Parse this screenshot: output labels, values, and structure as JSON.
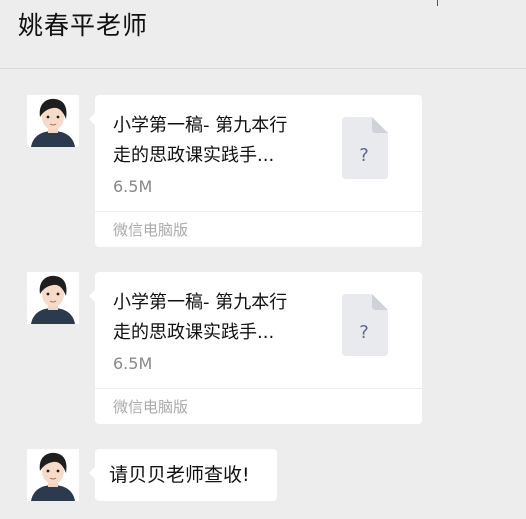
{
  "header": {
    "title": "姚春平老师"
  },
  "messages": [
    {
      "type": "file",
      "file_name": "小学第一稿- 第九本行走的思政课实践手...",
      "file_name_line1": "小学第一稿- 第九本行",
      "file_name_line2": "走的思政课实践手...",
      "size": "6.5M",
      "source": "微信电脑版",
      "icon": "unknown-file-icon",
      "icon_glyph": "?"
    },
    {
      "type": "file",
      "file_name": "小学第一稿- 第九本行走的思政课实践手...",
      "file_name_line1": "小学第一稿- 第九本行",
      "file_name_line2": "走的思政课实践手...",
      "size": "6.5M",
      "source": "微信电脑版",
      "icon": "unknown-file-icon",
      "icon_glyph": "?"
    },
    {
      "type": "text",
      "text": "请贝贝老师查收!"
    }
  ],
  "colors": {
    "background": "#ededed",
    "bubble": "#ffffff",
    "meta_text": "#888888",
    "file_icon": "#e8eaed"
  }
}
